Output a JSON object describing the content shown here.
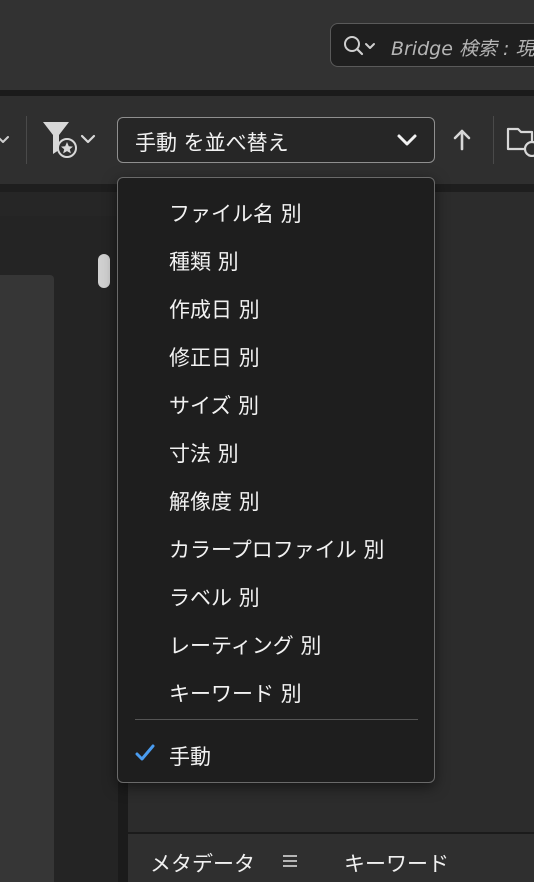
{
  "search": {
    "placeholder": "Bridge 検索 : 現"
  },
  "toolbar": {
    "sort_label": "手動 を並べ替え",
    "icons": {
      "filter": "filter-star-icon",
      "sort_dropdown_chevron": "chevron-down-icon",
      "ascend": "arrow-up-icon",
      "folder": "folder-recent-icon"
    }
  },
  "sort_menu": {
    "items": [
      {
        "label": "ファイル名 別"
      },
      {
        "label": "種類 別"
      },
      {
        "label": "作成日 別"
      },
      {
        "label": "修正日 別"
      },
      {
        "label": "サイズ 別"
      },
      {
        "label": "寸法 別"
      },
      {
        "label": "解像度 別"
      },
      {
        "label": "カラープロファイル 別"
      },
      {
        "label": "ラベル 別"
      },
      {
        "label": "レーティング 別"
      },
      {
        "label": "キーワード 別"
      }
    ],
    "selected": {
      "label": "手動",
      "icon": "checkmark-icon"
    }
  },
  "bottom_tabs": {
    "metadata": "メタデータ",
    "keywords": "キーワード"
  },
  "colors": {
    "accent_check": "#4a9cf0",
    "menu_bg": "#1e1e1e",
    "app_bg": "#2c2c2c"
  }
}
